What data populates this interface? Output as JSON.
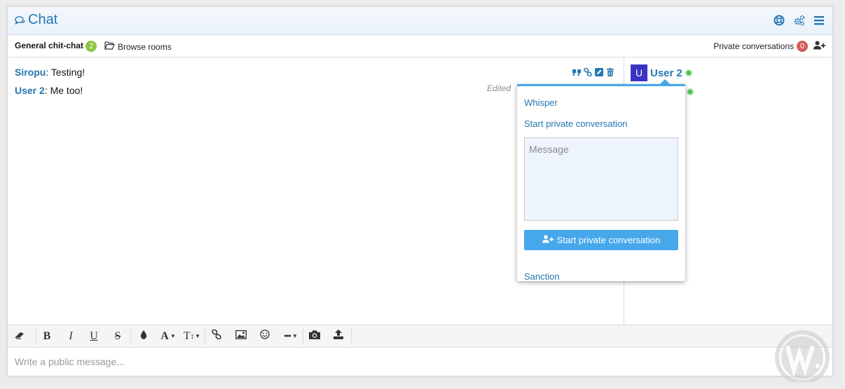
{
  "header": {
    "title": "Chat",
    "icons": [
      "chat-bubbles-icon",
      "help-lifebuoy-icon",
      "cogs-icon",
      "menu-icon"
    ]
  },
  "tabs": {
    "room_name": "General chit-chat",
    "room_count": "2",
    "browse_label": "Browse rooms",
    "private_label": "Private conversations",
    "private_count": "0"
  },
  "messages": [
    {
      "author": "Siropu",
      "text": ": Testing!"
    },
    {
      "author": "User 2",
      "text": ": Me too!"
    }
  ],
  "edited_label": "Edited",
  "userlist": {
    "avatar_letter": "U",
    "user_name": "User 2"
  },
  "popup": {
    "whisper": "Whisper",
    "start_private": "Start private conversation",
    "message_placeholder": "Message",
    "button_label": "Start private conversation",
    "sanction": "Sanction"
  },
  "editor": {
    "placeholder": "Write a public message..."
  },
  "toolbar": {
    "bold": "B",
    "italic": "I",
    "underline": "U",
    "strike": "S",
    "font": "A",
    "size": "T"
  },
  "colors": {
    "accent": "#2577b1",
    "button": "#47a7eb",
    "online": "#48c048",
    "room_badge": "#8cc63f",
    "private_badge": "#d65a5a",
    "avatar": "#3b33c4"
  }
}
